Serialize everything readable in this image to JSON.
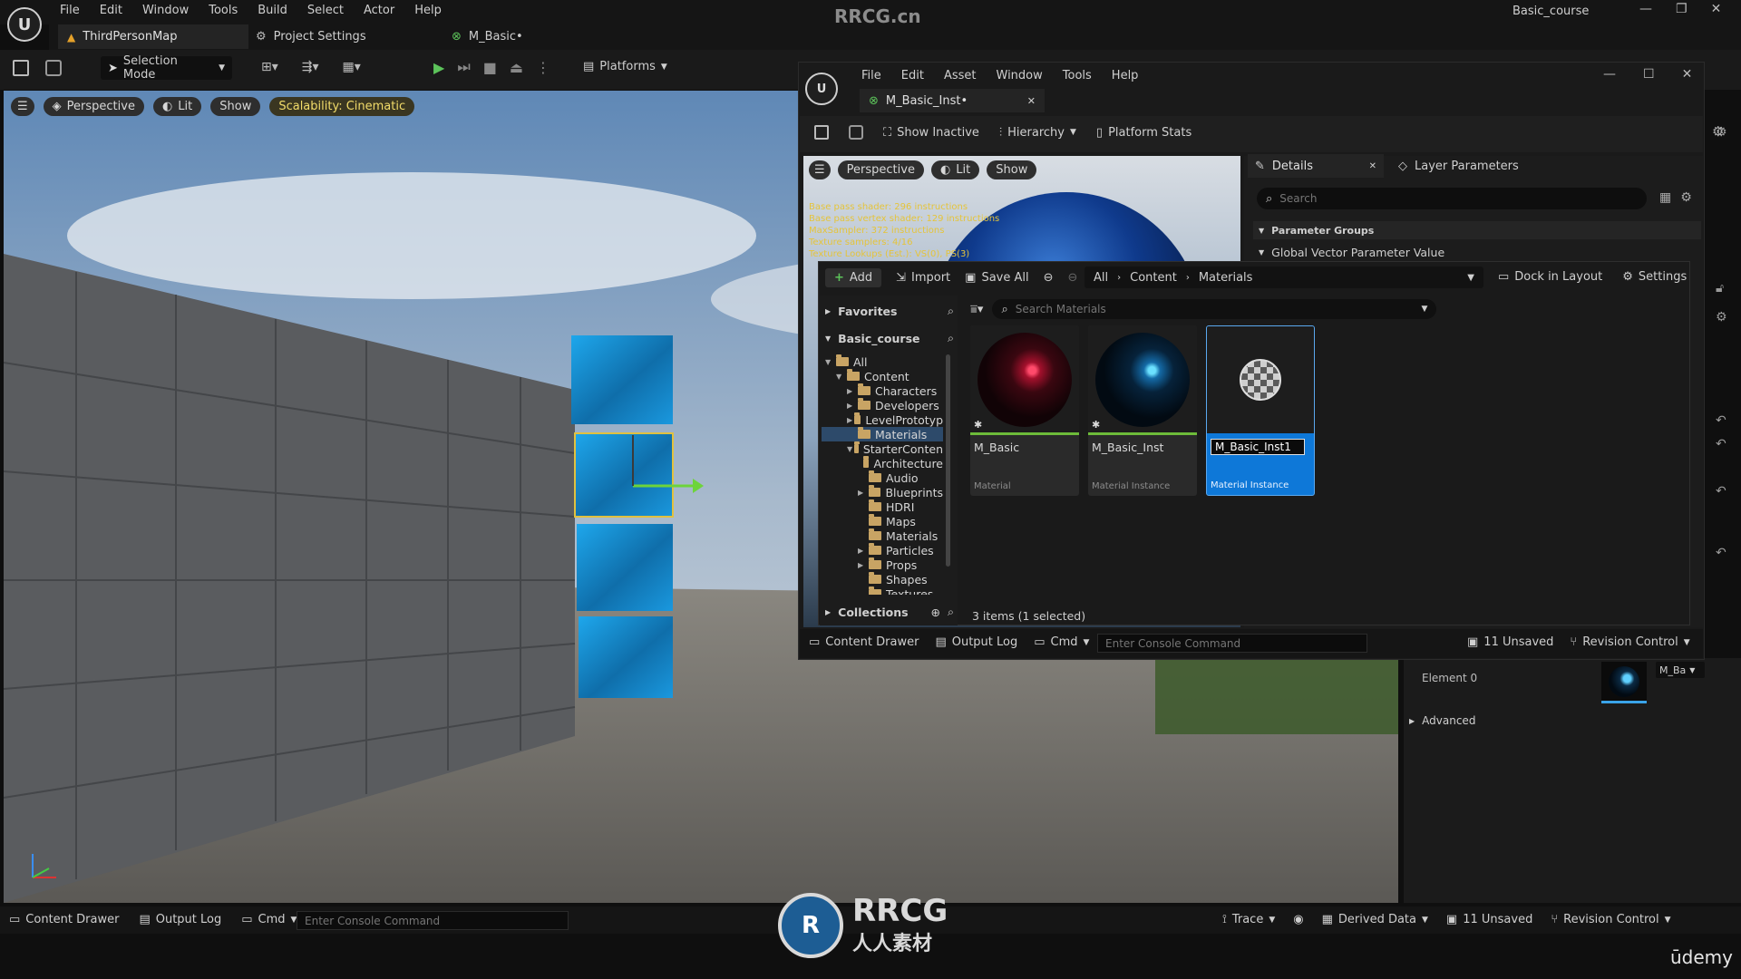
{
  "watermark": {
    "site": "RRCG.cn",
    "logo_text_top": "RRCG",
    "logo_text_bottom": "人人素材",
    "udemy": "ūdemy"
  },
  "main_menu": [
    "File",
    "Edit",
    "Window",
    "Tools",
    "Build",
    "Select",
    "Actor",
    "Help"
  ],
  "window_title": "Basic_course",
  "main_tabs": [
    "ThirdPersonMap",
    "Project Settings",
    "M_Basic•"
  ],
  "main_toolbar": {
    "selection_mode": "Selection Mode",
    "platforms": "Platforms"
  },
  "viewport": {
    "perspective": "Perspective",
    "lit": "Lit",
    "show": "Show",
    "scalability": "Scalability: Cinematic"
  },
  "material_editor": {
    "menu": [
      "File",
      "Edit",
      "Asset",
      "Window",
      "Tools",
      "Help"
    ],
    "tab": "M_Basic_Inst•",
    "toolbar": {
      "show_inactive": "Show Inactive",
      "hierarchy": "Hierarchy",
      "platform_stats": "Platform Stats"
    },
    "preview": {
      "perspective": "Perspective",
      "lit": "Lit",
      "show": "Show"
    },
    "stats": [
      "Base pass shader: 296 instructions",
      "Base pass vertex shader: 129 instructions",
      "MaxSampler: 372 instructions",
      "Texture samplers: 4/16",
      "Texture Lookups (Est.): VS(0), PS(3)"
    ],
    "details_tab": "Details",
    "layer_tab": "Layer Parameters",
    "search_placeholder": "Search",
    "param_groups": "Parameter Groups",
    "global_vector": "Global Vector Parameter Value",
    "status": {
      "content_drawer": "Content Drawer",
      "output_log": "Output Log",
      "cmd": "Cmd",
      "console_placeholder": "Enter Console Command",
      "unsaved": "11 Unsaved",
      "revision": "Revision Control"
    }
  },
  "content_browser": {
    "add": "Add",
    "import": "Import",
    "save_all": "Save All",
    "breadcrumb": [
      "All",
      "Content",
      "Materials"
    ],
    "dock": "Dock in Layout",
    "settings": "Settings",
    "favorites": "Favorites",
    "project": "Basic_course",
    "search_placeholder": "Search Materials",
    "tree": [
      {
        "label": "All",
        "depth": 0,
        "arrow": "▼"
      },
      {
        "label": "Content",
        "depth": 1,
        "arrow": "▼"
      },
      {
        "label": "Characters",
        "depth": 2,
        "arrow": "▶"
      },
      {
        "label": "Developers",
        "depth": 2,
        "arrow": "▶"
      },
      {
        "label": "LevelPrototyp",
        "depth": 2,
        "arrow": "▶"
      },
      {
        "label": "Materials",
        "depth": 2,
        "arrow": ""
      },
      {
        "label": "StarterConten",
        "depth": 2,
        "arrow": "▼"
      },
      {
        "label": "Architecture",
        "depth": 3,
        "arrow": ""
      },
      {
        "label": "Audio",
        "depth": 3,
        "arrow": ""
      },
      {
        "label": "Blueprints",
        "depth": 3,
        "arrow": "▶"
      },
      {
        "label": "HDRI",
        "depth": 3,
        "arrow": ""
      },
      {
        "label": "Maps",
        "depth": 3,
        "arrow": ""
      },
      {
        "label": "Materials",
        "depth": 3,
        "arrow": ""
      },
      {
        "label": "Particles",
        "depth": 3,
        "arrow": "▶"
      },
      {
        "label": "Props",
        "depth": 3,
        "arrow": "▶"
      },
      {
        "label": "Shapes",
        "depth": 3,
        "arrow": ""
      },
      {
        "label": "Textures",
        "depth": 3,
        "arrow": ""
      }
    ],
    "collections": "Collections",
    "assets": [
      {
        "name": "M_Basic",
        "type": "Material"
      },
      {
        "name": "M_Basic_Inst",
        "type": "Material Instance"
      },
      {
        "name": "M_Basic_Inst1",
        "type": "Material Instance"
      }
    ],
    "count": "3 items (1 selected)"
  },
  "details_panel": {
    "element0": "Element 0",
    "material_slot": "M_Ba",
    "advanced": "Advanced"
  },
  "bottom_bar": {
    "content_drawer": "Content Drawer",
    "output_log": "Output Log",
    "cmd": "Cmd",
    "console_placeholder": "Enter Console Command",
    "trace": "Trace",
    "derived_data": "Derived Data",
    "unsaved": "11 Unsaved",
    "revision": "Revision Control"
  },
  "colors": {
    "accent_blue": "#0e78d8",
    "green_bar": "#6dbb3a",
    "cube_blue": "#1a8fd6"
  }
}
